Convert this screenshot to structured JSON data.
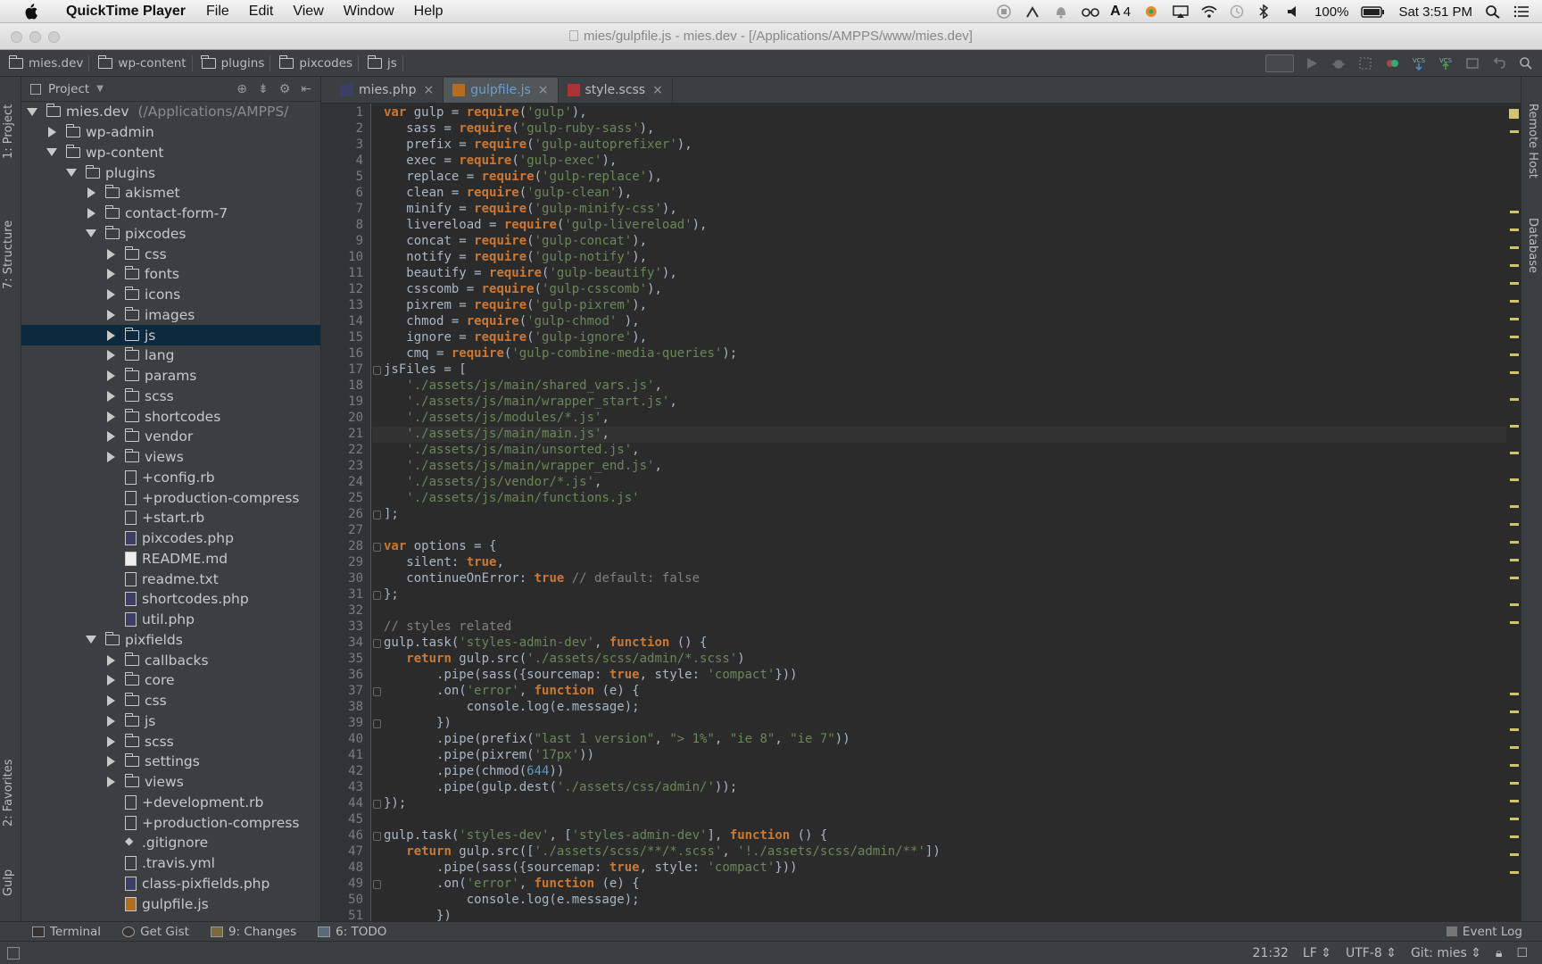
{
  "menubar": {
    "app": "QuickTime Player",
    "items": [
      "File",
      "Edit",
      "View",
      "Window",
      "Help"
    ],
    "status": {
      "notification_count": "4",
      "battery": "100%",
      "clock": "Sat 3:51 PM"
    }
  },
  "window": {
    "title": "mies/gulpfile.js - mies.dev - [/Applications/AMPPS/www/mies.dev]"
  },
  "breadcrumbs": [
    "mies.dev",
    "wp-content",
    "plugins",
    "pixcodes",
    "js"
  ],
  "left_strip": {
    "project": "1: Project",
    "structure": "7: Structure",
    "favorites": "2: Favorites",
    "gulp": "Gulp"
  },
  "right_strip": {
    "remote": "Remote Host",
    "database": "Database"
  },
  "project_panel": {
    "title": "Project",
    "tree": [
      {
        "label": "mies.dev",
        "sub": "(/Applications/AMPPS/",
        "depth": 0,
        "arrow": "d",
        "kind": "folder"
      },
      {
        "label": "wp-admin",
        "depth": 1,
        "arrow": "r",
        "kind": "folder"
      },
      {
        "label": "wp-content",
        "depth": 1,
        "arrow": "d",
        "kind": "folder"
      },
      {
        "label": "plugins",
        "depth": 2,
        "arrow": "d",
        "kind": "folder"
      },
      {
        "label": "akismet",
        "depth": 3,
        "arrow": "r",
        "kind": "folder"
      },
      {
        "label": "contact-form-7",
        "depth": 3,
        "arrow": "r",
        "kind": "folder"
      },
      {
        "label": "pixcodes",
        "depth": 3,
        "arrow": "d",
        "kind": "folder"
      },
      {
        "label": "css",
        "depth": 4,
        "arrow": "r",
        "kind": "folder"
      },
      {
        "label": "fonts",
        "depth": 4,
        "arrow": "r",
        "kind": "folder"
      },
      {
        "label": "icons",
        "depth": 4,
        "arrow": "r",
        "kind": "folder"
      },
      {
        "label": "images",
        "depth": 4,
        "arrow": "r",
        "kind": "folder"
      },
      {
        "label": "js",
        "depth": 4,
        "arrow": "r",
        "kind": "folder",
        "selected": true
      },
      {
        "label": "lang",
        "depth": 4,
        "arrow": "r",
        "kind": "folder"
      },
      {
        "label": "params",
        "depth": 4,
        "arrow": "r",
        "kind": "folder"
      },
      {
        "label": "scss",
        "depth": 4,
        "arrow": "r",
        "kind": "folder"
      },
      {
        "label": "shortcodes",
        "depth": 4,
        "arrow": "r",
        "kind": "folder"
      },
      {
        "label": "vendor",
        "depth": 4,
        "arrow": "r",
        "kind": "folder"
      },
      {
        "label": "views",
        "depth": 4,
        "arrow": "r",
        "kind": "folder"
      },
      {
        "label": "+config.rb",
        "depth": 4,
        "arrow": "n",
        "kind": "file"
      },
      {
        "label": "+production-compress",
        "depth": 4,
        "arrow": "n",
        "kind": "file"
      },
      {
        "label": "+start.rb",
        "depth": 4,
        "arrow": "n",
        "kind": "file"
      },
      {
        "label": "pixcodes.php",
        "depth": 4,
        "arrow": "n",
        "kind": "php"
      },
      {
        "label": "README.md",
        "depth": 4,
        "arrow": "n",
        "kind": "md"
      },
      {
        "label": "readme.txt",
        "depth": 4,
        "arrow": "n",
        "kind": "file"
      },
      {
        "label": "shortcodes.php",
        "depth": 4,
        "arrow": "n",
        "kind": "php"
      },
      {
        "label": "util.php",
        "depth": 4,
        "arrow": "n",
        "kind": "php"
      },
      {
        "label": "pixfields",
        "depth": 3,
        "arrow": "d",
        "kind": "folder"
      },
      {
        "label": "callbacks",
        "depth": 4,
        "arrow": "r",
        "kind": "folder"
      },
      {
        "label": "core",
        "depth": 4,
        "arrow": "r",
        "kind": "folder"
      },
      {
        "label": "css",
        "depth": 4,
        "arrow": "r",
        "kind": "folder"
      },
      {
        "label": "js",
        "depth": 4,
        "arrow": "r",
        "kind": "folder"
      },
      {
        "label": "scss",
        "depth": 4,
        "arrow": "r",
        "kind": "folder"
      },
      {
        "label": "settings",
        "depth": 4,
        "arrow": "r",
        "kind": "folder"
      },
      {
        "label": "views",
        "depth": 4,
        "arrow": "r",
        "kind": "folder"
      },
      {
        "label": "+development.rb",
        "depth": 4,
        "arrow": "n",
        "kind": "file"
      },
      {
        "label": "+production-compress",
        "depth": 4,
        "arrow": "n",
        "kind": "file"
      },
      {
        "label": ".gitignore",
        "depth": 4,
        "arrow": "n",
        "kind": "git"
      },
      {
        "label": ".travis.yml",
        "depth": 4,
        "arrow": "n",
        "kind": "file"
      },
      {
        "label": "class-pixfields.php",
        "depth": 4,
        "arrow": "n",
        "kind": "php"
      },
      {
        "label": "gulpfile.js",
        "depth": 4,
        "arrow": "n",
        "kind": "js"
      }
    ]
  },
  "tabs": [
    {
      "label": "mies.php",
      "active": false,
      "icon_color": "#3b3f66"
    },
    {
      "label": "gulpfile.js",
      "active": true,
      "icon_color": "#b56d1d"
    },
    {
      "label": "style.scss",
      "active": false,
      "icon_color": "#a33"
    }
  ],
  "editor": {
    "current_line": 21,
    "lines": [
      [
        [
          "kw",
          "var"
        ],
        [
          "t",
          " gulp = "
        ],
        [
          "kw",
          "require"
        ],
        [
          "t",
          "("
        ],
        [
          "str",
          "'gulp'"
        ],
        [
          "t",
          "),"
        ]
      ],
      [
        [
          "ws",
          "   "
        ],
        [
          "t",
          "sass = "
        ],
        [
          "kw",
          "require"
        ],
        [
          "t",
          "("
        ],
        [
          "str",
          "'gulp-ruby-sass'"
        ],
        [
          "t",
          "),"
        ]
      ],
      [
        [
          "ws",
          "   "
        ],
        [
          "t",
          "prefix = "
        ],
        [
          "kw",
          "require"
        ],
        [
          "t",
          "("
        ],
        [
          "str",
          "'gulp-autoprefixer'"
        ],
        [
          "t",
          "),"
        ]
      ],
      [
        [
          "ws",
          "   "
        ],
        [
          "t",
          "exec = "
        ],
        [
          "kw",
          "require"
        ],
        [
          "t",
          "("
        ],
        [
          "str",
          "'gulp-exec'"
        ],
        [
          "t",
          "),"
        ]
      ],
      [
        [
          "ws",
          "   "
        ],
        [
          "t",
          "replace = "
        ],
        [
          "kw",
          "require"
        ],
        [
          "t",
          "("
        ],
        [
          "str",
          "'gulp-replace'"
        ],
        [
          "t",
          "),"
        ]
      ],
      [
        [
          "ws",
          "   "
        ],
        [
          "t",
          "clean = "
        ],
        [
          "kw",
          "require"
        ],
        [
          "t",
          "("
        ],
        [
          "str",
          "'gulp-clean'"
        ],
        [
          "t",
          "),"
        ]
      ],
      [
        [
          "ws",
          "   "
        ],
        [
          "t",
          "minify = "
        ],
        [
          "kw",
          "require"
        ],
        [
          "t",
          "("
        ],
        [
          "str",
          "'gulp-minify-css'"
        ],
        [
          "t",
          "),"
        ]
      ],
      [
        [
          "ws",
          "   "
        ],
        [
          "t",
          "livereload = "
        ],
        [
          "kw",
          "require"
        ],
        [
          "t",
          "("
        ],
        [
          "str",
          "'gulp-livereload'"
        ],
        [
          "t",
          "),"
        ]
      ],
      [
        [
          "ws",
          "   "
        ],
        [
          "t",
          "concat = "
        ],
        [
          "kw",
          "require"
        ],
        [
          "t",
          "("
        ],
        [
          "str",
          "'gulp-concat'"
        ],
        [
          "t",
          "),"
        ]
      ],
      [
        [
          "ws",
          "   "
        ],
        [
          "t",
          "notify = "
        ],
        [
          "kw",
          "require"
        ],
        [
          "t",
          "("
        ],
        [
          "str",
          "'gulp-notify'"
        ],
        [
          "t",
          "),"
        ]
      ],
      [
        [
          "ws",
          "   "
        ],
        [
          "t",
          "beautify = "
        ],
        [
          "kw",
          "require"
        ],
        [
          "t",
          "("
        ],
        [
          "str",
          "'gulp-beautify'"
        ],
        [
          "t",
          "),"
        ]
      ],
      [
        [
          "ws",
          "   "
        ],
        [
          "t",
          "csscomb = "
        ],
        [
          "kw",
          "require"
        ],
        [
          "t",
          "("
        ],
        [
          "str",
          "'gulp-csscomb'"
        ],
        [
          "t",
          "),"
        ]
      ],
      [
        [
          "ws",
          "   "
        ],
        [
          "t",
          "pixrem = "
        ],
        [
          "kw",
          "require"
        ],
        [
          "t",
          "("
        ],
        [
          "str",
          "'gulp-pixrem'"
        ],
        [
          "t",
          "),"
        ]
      ],
      [
        [
          "ws",
          "   "
        ],
        [
          "t",
          "chmod = "
        ],
        [
          "kw",
          "require"
        ],
        [
          "t",
          "("
        ],
        [
          "str",
          "'gulp-chmod' "
        ],
        [
          "t",
          "),"
        ]
      ],
      [
        [
          "ws",
          "   "
        ],
        [
          "t",
          "ignore = "
        ],
        [
          "kw",
          "require"
        ],
        [
          "t",
          "("
        ],
        [
          "str",
          "'gulp-ignore'"
        ],
        [
          "t",
          "),"
        ]
      ],
      [
        [
          "ws",
          "   "
        ],
        [
          "t",
          "cmq = "
        ],
        [
          "kw",
          "require"
        ],
        [
          "t",
          "("
        ],
        [
          "str",
          "'gulp-combine-media-queries'"
        ],
        [
          "t",
          ");"
        ]
      ],
      [
        [
          "t",
          "jsFiles = ["
        ]
      ],
      [
        [
          "ws",
          "   "
        ],
        [
          "str",
          "'./assets/js/main/shared_vars.js'"
        ],
        [
          "t",
          ","
        ]
      ],
      [
        [
          "ws",
          "   "
        ],
        [
          "str",
          "'./assets/js/main/wrapper_start.js'"
        ],
        [
          "t",
          ","
        ]
      ],
      [
        [
          "ws",
          "   "
        ],
        [
          "str",
          "'./assets/js/modules/*.js'"
        ],
        [
          "t",
          ","
        ]
      ],
      [
        [
          "ws",
          "   "
        ],
        [
          "str",
          "'./assets/js/main/main.js'"
        ],
        [
          "t",
          ","
        ]
      ],
      [
        [
          "ws",
          "   "
        ],
        [
          "str",
          "'./assets/js/main/unsorted.js'"
        ],
        [
          "t",
          ","
        ]
      ],
      [
        [
          "ws",
          "   "
        ],
        [
          "str",
          "'./assets/js/main/wrapper_end.js'"
        ],
        [
          "t",
          ","
        ]
      ],
      [
        [
          "ws",
          "   "
        ],
        [
          "str",
          "'./assets/js/vendor/*.js'"
        ],
        [
          "t",
          ","
        ]
      ],
      [
        [
          "ws",
          "   "
        ],
        [
          "str",
          "'./assets/js/main/functions.js'"
        ]
      ],
      [
        [
          "t",
          "];"
        ]
      ],
      [
        [
          "t",
          ""
        ]
      ],
      [
        [
          "kw",
          "var"
        ],
        [
          "t",
          " options = {"
        ]
      ],
      [
        [
          "ws",
          "   "
        ],
        [
          "t",
          "silent: "
        ],
        [
          "kw",
          "true"
        ],
        [
          "t",
          ","
        ]
      ],
      [
        [
          "ws",
          "   "
        ],
        [
          "t",
          "continueOnError: "
        ],
        [
          "kw",
          "true"
        ],
        [
          "t",
          " "
        ],
        [
          "cm",
          "// default: false"
        ]
      ],
      [
        [
          "t",
          "};"
        ]
      ],
      [
        [
          "t",
          ""
        ]
      ],
      [
        [
          "cm",
          "// styles related"
        ]
      ],
      [
        [
          "t",
          "gulp.task("
        ],
        [
          "str",
          "'styles-admin-dev'"
        ],
        [
          "t",
          ", "
        ],
        [
          "kw",
          "function"
        ],
        [
          "t",
          " () {"
        ]
      ],
      [
        [
          "ws",
          "   "
        ],
        [
          "kw",
          "return"
        ],
        [
          "t",
          " gulp.src("
        ],
        [
          "str",
          "'./assets/scss/admin/*.scss'"
        ],
        [
          "t",
          ")"
        ]
      ],
      [
        [
          "ws",
          "       "
        ],
        [
          "t",
          ".pipe(sass({sourcemap: "
        ],
        [
          "kw",
          "true"
        ],
        [
          "t",
          ", style: "
        ],
        [
          "str",
          "'compact'"
        ],
        [
          "t",
          "}))"
        ]
      ],
      [
        [
          "ws",
          "       "
        ],
        [
          "t",
          ".on("
        ],
        [
          "str",
          "'error'"
        ],
        [
          "t",
          ", "
        ],
        [
          "kw",
          "function"
        ],
        [
          "t",
          " (e) {"
        ]
      ],
      [
        [
          "ws",
          "           "
        ],
        [
          "t",
          "console.log(e.message);"
        ]
      ],
      [
        [
          "ws",
          "       "
        ],
        [
          "t",
          "})"
        ]
      ],
      [
        [
          "ws",
          "       "
        ],
        [
          "t",
          ".pipe(prefix("
        ],
        [
          "str",
          "\"last 1 version\""
        ],
        [
          "t",
          ", "
        ],
        [
          "str",
          "\"> 1%\""
        ],
        [
          "t",
          ", "
        ],
        [
          "str",
          "\"ie 8\""
        ],
        [
          "t",
          ", "
        ],
        [
          "str",
          "\"ie 7\""
        ],
        [
          "t",
          "))"
        ]
      ],
      [
        [
          "ws",
          "       "
        ],
        [
          "t",
          ".pipe(pixrem("
        ],
        [
          "str",
          "'17px'"
        ],
        [
          "t",
          "))"
        ]
      ],
      [
        [
          "ws",
          "       "
        ],
        [
          "t",
          ".pipe(chmod("
        ],
        [
          "num",
          "644"
        ],
        [
          "t",
          "))"
        ]
      ],
      [
        [
          "ws",
          "       "
        ],
        [
          "t",
          ".pipe(gulp.dest("
        ],
        [
          "str",
          "'./assets/css/admin/'"
        ],
        [
          "t",
          "));"
        ]
      ],
      [
        [
          "t",
          "});"
        ]
      ],
      [
        [
          "t",
          ""
        ]
      ],
      [
        [
          "t",
          "gulp.task("
        ],
        [
          "str",
          "'styles-dev'"
        ],
        [
          "t",
          ", ["
        ],
        [
          "str",
          "'styles-admin-dev'"
        ],
        [
          "t",
          "], "
        ],
        [
          "kw",
          "function"
        ],
        [
          "t",
          " () {"
        ]
      ],
      [
        [
          "ws",
          "   "
        ],
        [
          "kw",
          "return"
        ],
        [
          "t",
          " gulp.src(["
        ],
        [
          "str",
          "'./assets/scss/**/*.scss'"
        ],
        [
          "t",
          ", "
        ],
        [
          "str",
          "'!./assets/scss/admin/**'"
        ],
        [
          "t",
          "])"
        ]
      ],
      [
        [
          "ws",
          "       "
        ],
        [
          "t",
          ".pipe(sass({sourcemap: "
        ],
        [
          "kw",
          "true"
        ],
        [
          "t",
          ", style: "
        ],
        [
          "str",
          "'compact'"
        ],
        [
          "t",
          "}))"
        ]
      ],
      [
        [
          "ws",
          "       "
        ],
        [
          "t",
          ".on("
        ],
        [
          "str",
          "'error'"
        ],
        [
          "t",
          ", "
        ],
        [
          "kw",
          "function"
        ],
        [
          "t",
          " (e) {"
        ]
      ],
      [
        [
          "ws",
          "           "
        ],
        [
          "t",
          "console.log(e.message);"
        ]
      ],
      [
        [
          "ws",
          "       "
        ],
        [
          "t",
          "})"
        ]
      ]
    ]
  },
  "toolwindows": [
    {
      "label": "Terminal"
    },
    {
      "label": "Get Gist"
    },
    {
      "label": "9: Changes"
    },
    {
      "label": "6: TODO"
    }
  ],
  "event_log": "Event Log",
  "status": {
    "position": "21:32",
    "line_sep": "LF",
    "encoding": "UTF-8",
    "git": "Git: mies"
  }
}
